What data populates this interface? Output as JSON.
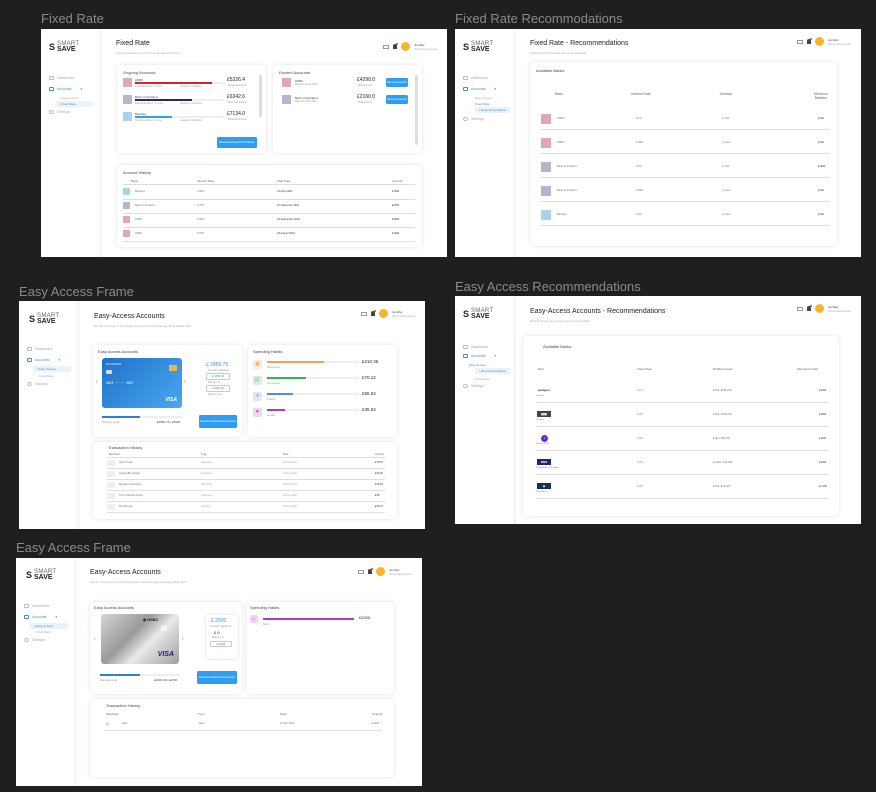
{
  "frames": {
    "f1": "Fixed Rate",
    "f2": "Fixed Rate Recommodations",
    "f3": "Easy Access Frame",
    "f4": "Easy Access Recommendations",
    "f5": "Easy Access Frame"
  },
  "brand": {
    "ss": "S",
    "top": "SMART",
    "bottom": "SAVE"
  },
  "user": {
    "name": "Jennifer",
    "role": "Personal account"
  },
  "nav": {
    "dashboard": "Dashboard",
    "accounts": "Accounts",
    "easy_access": "Easy Access",
    "fixed_rate": "Fixed Rate",
    "recommendations": "Recommendations",
    "settings": "Settings"
  },
  "fixed_rate": {
    "title": "Fixed Rate",
    "subtitle": "Get an overview of your fixed rate accounts here",
    "ongoing_title": "Ongoing Accounts",
    "expired_title": "Expired Accounts",
    "ongoing": [
      {
        "bank": "HSBC",
        "detail": "Fixed Rate Bond · 1 Year",
        "progress": "Expires in 120 days",
        "amount": "£5326.4",
        "amount_note": "Projected amount",
        "color": "#e0a8b1",
        "bar": "#d8232a",
        "pct": 0.88
      },
      {
        "bank": "Bank of Scotland",
        "detail": "Fixed Rate Bond · 2 Years",
        "progress": "Expires in 200 days",
        "amount": "£6342.6",
        "amount_note": "Projected amount",
        "color": "#b4b7cc",
        "bar": "#1f2b6b",
        "pct": 0.65
      },
      {
        "bank": "Barclays",
        "detail": "Fixed Rate Bond · 1 Year",
        "progress": "Expires in 300 days",
        "amount": "£7134.0",
        "amount_note": "Projected amount",
        "color": "#a9d3e9",
        "bar": "#28a6de",
        "pct": 0.42
      }
    ],
    "expired": [
      {
        "bank": "HSBC",
        "detail": "Matured 12 Jan 2022",
        "amount": "£4290.0",
        "amount_note": "Final amount",
        "btn": "Renew Account",
        "color": "#e0a8b1"
      },
      {
        "bank": "Bank of Scotland",
        "detail": "Matured 4 Mar 2022",
        "amount": "£2160.0",
        "amount_note": "Final amount",
        "btn": "Renew Account",
        "color": "#b4b7cc"
      }
    ],
    "recommend_btn": "Recommended Fixed Bonds",
    "history_title": "Account History",
    "history_headers": [
      "Bank",
      "Interest Rate",
      "Start Date",
      "Amount"
    ],
    "history": [
      {
        "bank": "Barclays",
        "rate": "1.95%",
        "date": "14 April 2020",
        "amount": "£7000",
        "color": "#a9d3e9"
      },
      {
        "bank": "Bank of Scotland",
        "rate": "0.75%",
        "date": "27 November 2021",
        "amount": "£2000",
        "color": "#b4b7cc"
      },
      {
        "bank": "HSBC",
        "rate": "1.50%",
        "date": "22 September 2019",
        "amount": "£3000",
        "color": "#e0a8b1"
      },
      {
        "bank": "HSBC",
        "rate": "0.75%",
        "date": "18 August 2021",
        "amount": "£4000",
        "color": "#e0a8b1"
      }
    ]
  },
  "fixed_rec": {
    "title": "Fixed Rate - Recommendations",
    "subtitle": "Find the best fixed rate accounts available",
    "card_title": "Available Banks",
    "headers": [
      "Bank",
      "Interest Rate",
      "Duration",
      "Minimum Balance"
    ],
    "rows": [
      {
        "bank": "HSBC",
        "rate": "3.1%",
        "duration": "1 Year",
        "min": "£100",
        "color": "#e0a8b1"
      },
      {
        "bank": "HSBC",
        "rate": "3.45%",
        "duration": "2 Years",
        "min": "£100",
        "color": "#e0a8b1"
      },
      {
        "bank": "Bank of Scotland",
        "rate": "3.2%",
        "duration": "1 Year",
        "min": "£1000",
        "color": "#b4b7cc"
      },
      {
        "bank": "Bank of Scotland",
        "rate": "3.55%",
        "duration": "2 Years",
        "min": "£100",
        "color": "#b4b7cc"
      },
      {
        "bank": "Barclays",
        "rate": "3.6%",
        "duration": "3 Years",
        "min": "£100",
        "color": "#a9d3e9"
      }
    ]
  },
  "easy1": {
    "title": "Easy-Access Accounts",
    "subtitle": "Get an overview of your Easy Access accounts and spending habits here",
    "accounts_title": "Easy Access Accounts",
    "card_label": "PLATINUM",
    "card_number": "5163   ·····   ·····   3847",
    "card_brand": "VISA",
    "balance": "£ 2850.75",
    "balance_note": "Current balance",
    "in": "£ 1856.30",
    "in_note": "Money in",
    "out": "£ 206.40",
    "out_note": "Money out",
    "goal_note": "Savings goal",
    "goal": "£2850.75 / £5000",
    "recommend_btn": "Recommended Easy Access",
    "spending_title": "Spending Habits",
    "spending": [
      {
        "cat": "Shopping",
        "amount": "£210.36",
        "color": "#f5a05a",
        "pct": 0.62
      },
      {
        "cat": "Groceries",
        "amount": "£70.12",
        "color": "#38b34a",
        "pct": 0.42
      },
      {
        "cat": "Travel",
        "amount": "£55.04",
        "color": "#4a8fe2",
        "pct": 0.28
      },
      {
        "cat": "Health",
        "amount": "£35.04",
        "color": "#b534d4",
        "pct": 0.2
      }
    ],
    "tx_title": "Transaction History",
    "tx_headers": [
      "Merchant",
      "Type",
      "Date",
      "Amount"
    ],
    "tx": [
      {
        "name": "Sport Outlet",
        "type": "Shopping",
        "date": "12 Apr 2022",
        "amount": "£70.87"
      },
      {
        "name": "Galaxy/Bio Market",
        "type": "Groceries",
        "date": "14 Apr 2022",
        "amount": "£20.00"
      },
      {
        "name": "Morgan & Donnelly",
        "type": "Shopping",
        "date": "16 Apr 2022",
        "amount": "£25.60"
      },
      {
        "name": "Tom's Meuble Dépôt",
        "type": "Shopping",
        "date": "18 Apr 2022",
        "amount": "£18"
      },
      {
        "name": "Rent/Rental",
        "type": "Housing",
        "date": "20 Apr 2022",
        "amount": "£30.76"
      }
    ]
  },
  "easy_rec": {
    "title": "Easy-Access Accounts - Recommendations",
    "subtitle": "Find the best easy access accounts available",
    "card_title": "Available Banks",
    "headers": [
      "Bank",
      "Interest Rate",
      "Min/Max Deposit",
      "Max Interest Claim"
    ],
    "rows": [
      {
        "bank": "Paragon",
        "rate": "2.1%",
        "dep": "£100 / £250,000",
        "max": "£1000"
      },
      {
        "bank": "Chetlow",
        "rate": "2.2%",
        "dep": "£200 / £200,000",
        "max": "£4000"
      },
      {
        "bank": "Starling Bank",
        "rate": "2.3%",
        "dep": "£110 / £50,000",
        "max": "£1100"
      },
      {
        "bank": "Royal Bank of Scotland",
        "rate": "2.7%",
        "dep": "£1,000 / £10,000",
        "max": "£1000"
      },
      {
        "bank": "Zopa Bank",
        "rate": "2.2%",
        "dep": "£100 / £10,000",
        "max": "£1,100"
      }
    ]
  },
  "easy2": {
    "title": "Easy-Access Accounts",
    "subtitle": "Get an overview of your Easy Access accounts and spending habits here",
    "accounts_title": "Easy Access Accounts",
    "card_bank": "HSBC",
    "card_brand": "VISA",
    "balance": "£ 2000",
    "balance_note": "Current balance",
    "in": "£ 0",
    "in_note": "Money in",
    "out": "£ 2000",
    "goal_note": "Savings goal",
    "goal": "£2000.00 / £4000",
    "recommend_btn": "Recommended Easy Access",
    "spending_title": "Spending Habits",
    "spend_cat": "Rent",
    "spend_amount": "£2000",
    "spend_pct": 0.95,
    "tx_title": "Transaction History",
    "tx_headers": [
      "Merchant",
      "Type",
      "Date",
      "Amount"
    ],
    "tx_name": "Rent",
    "tx_type": "Rent",
    "tx_date": "12 Mar 2022",
    "tx_amount": "£2000"
  }
}
